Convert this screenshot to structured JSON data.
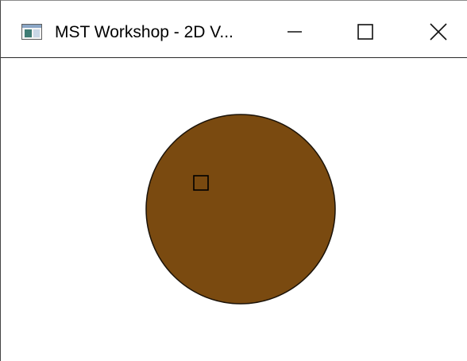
{
  "window": {
    "title": "MST Workshop - 2D V...",
    "controls": {
      "minimize_icon": "minimize-icon",
      "maximize_icon": "maximize-icon",
      "close_icon": "close-icon"
    }
  },
  "canvas": {
    "background_color": "#ffffff",
    "shapes": [
      {
        "kind": "circle",
        "fill": "#7a4a10",
        "stroke": "#1a1208"
      },
      {
        "kind": "square-marker",
        "fill": "none",
        "stroke": "#000000"
      }
    ]
  }
}
